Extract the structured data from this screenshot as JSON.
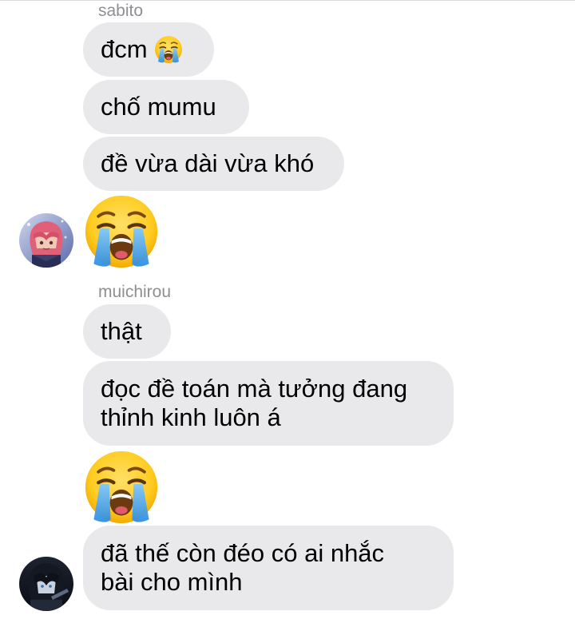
{
  "conversation": {
    "groups": [
      {
        "sender": "sabito",
        "messages": [
          {
            "text": "đcm",
            "emoji": "loudly-crying-face"
          },
          {
            "text": "chố mumu"
          },
          {
            "text": "đề vừa dài vừa khó"
          },
          {
            "emoji": "loudly-crying-face"
          }
        ],
        "avatar": "avatar-sabito"
      },
      {
        "sender": "muichirou",
        "messages": [
          {
            "text": "thật"
          },
          {
            "lines": [
              "đọc đề toán mà tưởng đang",
              "thỉnh kinh luôn á"
            ]
          },
          {
            "emoji": "loudly-crying-face"
          },
          {
            "lines": [
              "đã thế còn đéo có ai nhắc",
              "bài cho mình"
            ]
          }
        ],
        "avatar": "avatar-muichirou"
      }
    ]
  },
  "colors": {
    "bubble": "#e9e9eb",
    "sender_label": "#8e8e93",
    "text": "#000000"
  }
}
